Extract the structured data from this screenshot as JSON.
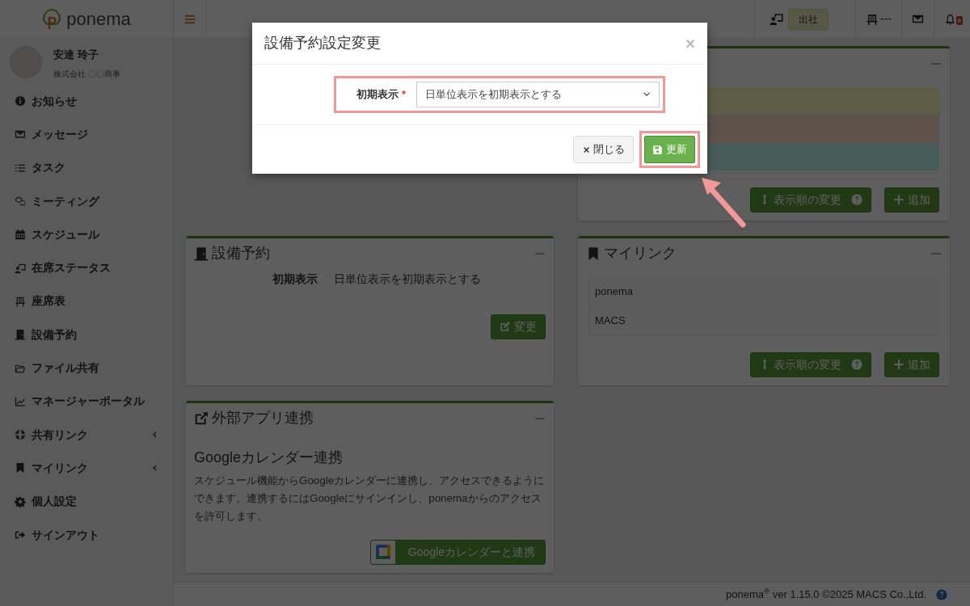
{
  "brand": {
    "name": "ponema"
  },
  "topbar": {
    "status_badge": "出社",
    "seat": "---",
    "notification_count": "8"
  },
  "user": {
    "name": "安達 玲子",
    "company": "株式会社 〇〇商事"
  },
  "sidebar": {
    "items": [
      {
        "label": "お知らせ",
        "kind": "link"
      },
      {
        "label": "メッセージ",
        "kind": "link"
      },
      {
        "label": "タスク",
        "kind": "link"
      },
      {
        "label": "ミーティング",
        "kind": "link"
      },
      {
        "label": "スケジュール",
        "kind": "link"
      },
      {
        "label": "在席ステータス",
        "kind": "link"
      },
      {
        "label": "座席表",
        "kind": "link"
      },
      {
        "label": "設備予約",
        "kind": "link"
      },
      {
        "label": "ファイル共有",
        "kind": "link"
      },
      {
        "label": "マネージャーポータル",
        "kind": "link"
      },
      {
        "label": "共有リンク",
        "kind": "submenu"
      },
      {
        "label": "マイリンク",
        "kind": "submenu"
      },
      {
        "label": "個人設定",
        "kind": "link"
      },
      {
        "label": "サインアウト",
        "kind": "link"
      }
    ]
  },
  "status_card": {
    "rows": [
      {
        "color": "#5d5c46"
      },
      {
        "color": "#5c524a"
      },
      {
        "color": "#485c5a"
      }
    ],
    "reorder_button": "表示順の変更",
    "add_button": "追加"
  },
  "facility_card": {
    "title": "設備予約",
    "field_label": "初期表示",
    "field_value": "日単位表示を初期表示とする",
    "edit_button": "変更"
  },
  "mylink_card": {
    "title": "マイリンク",
    "links": [
      "ponema",
      "MACS"
    ],
    "reorder_button": "表示順の変更",
    "add_button": "追加"
  },
  "external_card": {
    "title": "外部アプリ連携",
    "heading": "Googleカレンダー連携",
    "description": "スケジュール機能からGoogleカレンダーに連携し、アクセスできるようにできます。連携するにはGoogleにサインインし、ponemaからのアクセスを許可します。",
    "connect_button": "Googleカレンダーと連携"
  },
  "footer": {
    "text": "ponema$^{®}$ ver 1.15.0 ©2025 MACS Co.,Ltd."
  },
  "modal": {
    "title": "設備予約設定変更",
    "close_symbol": "×",
    "field_label": "初期表示",
    "required_mark": "*",
    "select_value": "日単位表示を初期表示とする",
    "close_button": "閉じる",
    "save_button": "更新"
  }
}
